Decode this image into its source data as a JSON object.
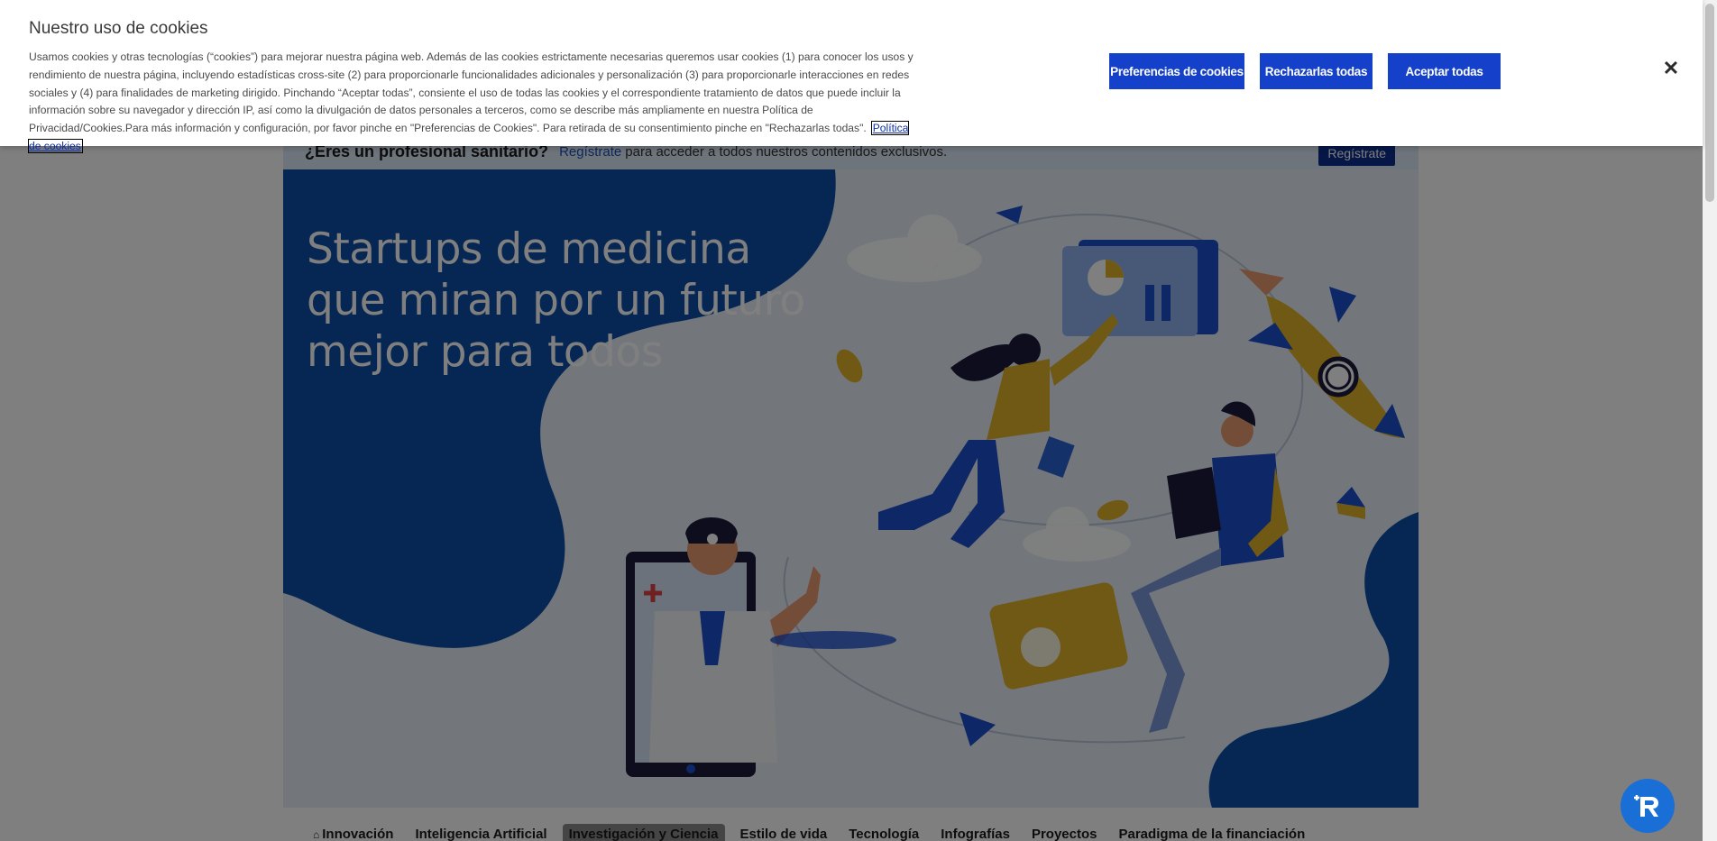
{
  "page": {
    "register_bar": {
      "question": "¿Eres un profesional sanitario?",
      "link": "Regístrate",
      "text": "para acceder a todos nuestros contenidos exclusivos.",
      "button": "Regístrate"
    },
    "hero": {
      "title": "Startups de medicina que miran por un futuro mejor para todos"
    },
    "category_nav": [
      {
        "label": "Innovación",
        "icon": "home-icon",
        "active": false
      },
      {
        "label": "Inteligencia Artificial",
        "active": false
      },
      {
        "label": "Investigación y Ciencia",
        "active": true
      },
      {
        "label": "Estilo de vida",
        "active": false
      },
      {
        "label": "Tecnología",
        "active": false
      },
      {
        "label": "Infografías",
        "active": false
      },
      {
        "label": "Proyectos",
        "active": false
      },
      {
        "label": "Paradigma de la financiación",
        "active": false
      }
    ]
  },
  "cookie_banner": {
    "title": "Nuestro uso de cookies",
    "body": "Usamos cookies y otras tecnologías (“cookies”) para mejorar nuestra página web. Además de las cookies estrictamente necesarias queremos usar cookies (1) para conocer los usos y rendimiento de nuestra página, incluyendo estadísticas cross-site (2) para proporcionarle funcionalidades adicionales y personalización (3) para proporcionarle interacciones en redes sociales y (4) para finalidades de marketing dirigido. Pinchando “Aceptar todas”, consiente el uso de todas las cookies y el correspondiente tratamiento de datos que puede incluir la información sobre su navegador y dirección IP, así como la divulgación de datos personales a terceros, como se describe más ampliamente en nuestra Política de Privacidad/Cookies.Para más información y configuración, por favor pinche en \"Preferencias de Cookies\". Para retirada de su consentimiento pinche en \"Rechazarlas todas\".",
    "policy_link": "Política de cookies",
    "buttons": {
      "preferences": "Preferencias de cookies",
      "reject": "Rechazarlas todas",
      "accept": "Aceptar todas"
    },
    "close_icon": "close-icon",
    "close_glyph": "✕"
  },
  "colors": {
    "button_blue": "#1540c9",
    "hero_blue": "#0d4fa8",
    "chat_blue": "#1a6fd6"
  }
}
